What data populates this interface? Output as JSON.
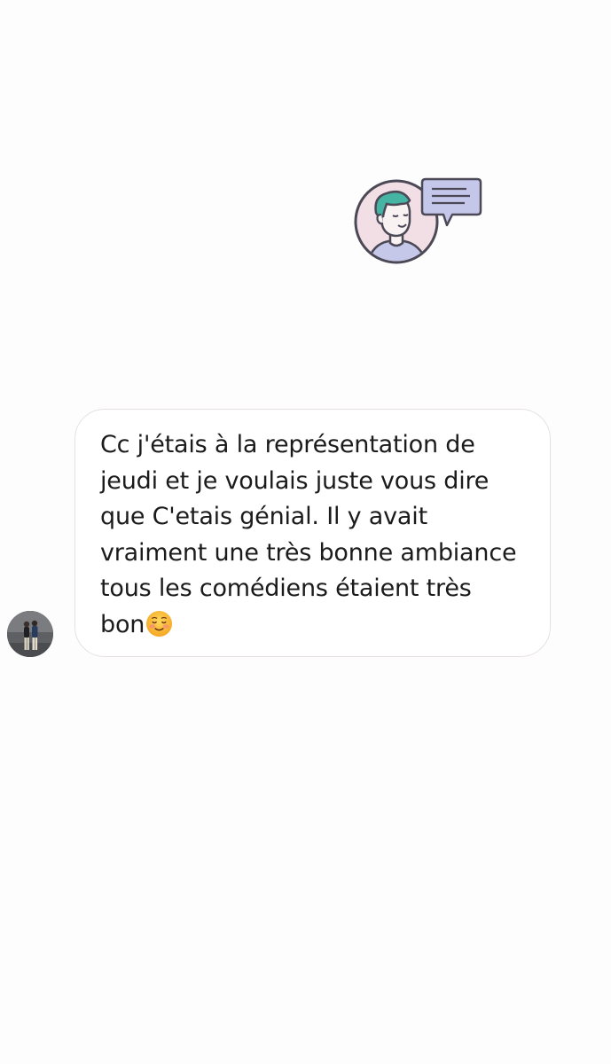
{
  "illustration": {
    "icon": "person-with-speech-bubble-icon",
    "colors": {
      "circle_fill": "#f1dfe5",
      "outline": "#4c4957",
      "hair": "#45b4a2",
      "shirt": "#c5c8e9",
      "bubble": "#c4c7ea"
    }
  },
  "message": {
    "avatar": "sender-avatar",
    "lines": [
      "Cc j'étais à la représentation de",
      "jeudi et je voulais juste vous dire",
      "que C'etais génial. Il y avait",
      "vraiment une très bonne ambiance",
      "tous les comédiens étaient très",
      "bon"
    ],
    "emoji": "smiling-face-icon",
    "bubble_border_color": "#e7e0e3",
    "text_color": "#1b1b1b"
  }
}
